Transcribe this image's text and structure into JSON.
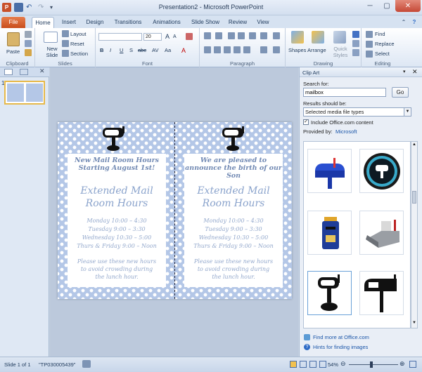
{
  "window": {
    "title": "Presentation2 - Microsoft PowerPoint"
  },
  "tabs": [
    {
      "label": "File"
    },
    {
      "label": "Home"
    },
    {
      "label": "Insert"
    },
    {
      "label": "Design"
    },
    {
      "label": "Transitions"
    },
    {
      "label": "Animations"
    },
    {
      "label": "Slide Show"
    },
    {
      "label": "Review"
    },
    {
      "label": "View"
    }
  ],
  "ribbon": {
    "clipboard": {
      "name": "Clipboard",
      "paste": "Paste"
    },
    "slides": {
      "name": "Slides",
      "new_slide": "New Slide",
      "layout": "Layout",
      "reset": "Reset",
      "section": "Section"
    },
    "font": {
      "name": "Font",
      "size": "20",
      "grow": "A",
      "shrink": "A",
      "bold": "B",
      "italic": "I",
      "underline": "U",
      "strike": "S",
      "abc": "abc",
      "av": "AV",
      "aa": "Aa",
      "color": "A"
    },
    "paragraph": {
      "name": "Paragraph"
    },
    "drawing": {
      "name": "Drawing",
      "shapes": "Shapes",
      "arrange": "Arrange",
      "quick_styles": "Quick Styles"
    },
    "editing": {
      "name": "Editing",
      "find": "Find",
      "replace": "Replace",
      "select": "Select"
    }
  },
  "slides_pane": {
    "slide_number": "1"
  },
  "slide": {
    "left_card": {
      "heading": [
        "New Mail Room Hours",
        "Starting August 1st!"
      ],
      "big": [
        "Extended Mail",
        "Room Hours"
      ],
      "schedule": [
        "Monday 10:00 – 4:30",
        "Tuesday 9:00 – 3:30",
        "Wednesday 10:30 – 5:00",
        "Thurs & Friday 9:00 – Noon"
      ],
      "note": [
        "Please use these new hours",
        "to avoid crowding during",
        "the lunch hour."
      ]
    },
    "right_card": {
      "heading": [
        "We are pleased to",
        "announce the birth of our",
        "Son"
      ],
      "big": [
        "Extended Mail",
        "Room Hours"
      ],
      "schedule": [
        "Monday 10:00 – 4:30",
        "Tuesday 9:00 – 3:30",
        "Wednesday 10:30 – 5:00",
        "Thurs & Friday 9:00 – Noon"
      ],
      "note": [
        "Please use these new hours",
        "to avoid crowding during",
        "the lunch hour."
      ]
    }
  },
  "clipart": {
    "title": "Clip Art",
    "search_label": "Search for:",
    "search_value": "mailbox",
    "go": "Go",
    "results_label": "Results should be:",
    "results_value": "Selected media file types",
    "include_label": "Include Office.com content",
    "include_checked": true,
    "provided_label": "Provided by:",
    "provided_value": "Microsoft",
    "find_more": "Find more at Office.com",
    "hints": "Hints for finding images",
    "results": [
      "blue-mailbox",
      "round-mailbox-button",
      "blue-post-box",
      "open-gray-mailbox",
      "black-mailbox-stand",
      "black-mailbox-line-art"
    ]
  },
  "status": {
    "slide_of": "Slide 1 of 1",
    "theme": "\"TP030005439\"",
    "zoom": "54%"
  }
}
